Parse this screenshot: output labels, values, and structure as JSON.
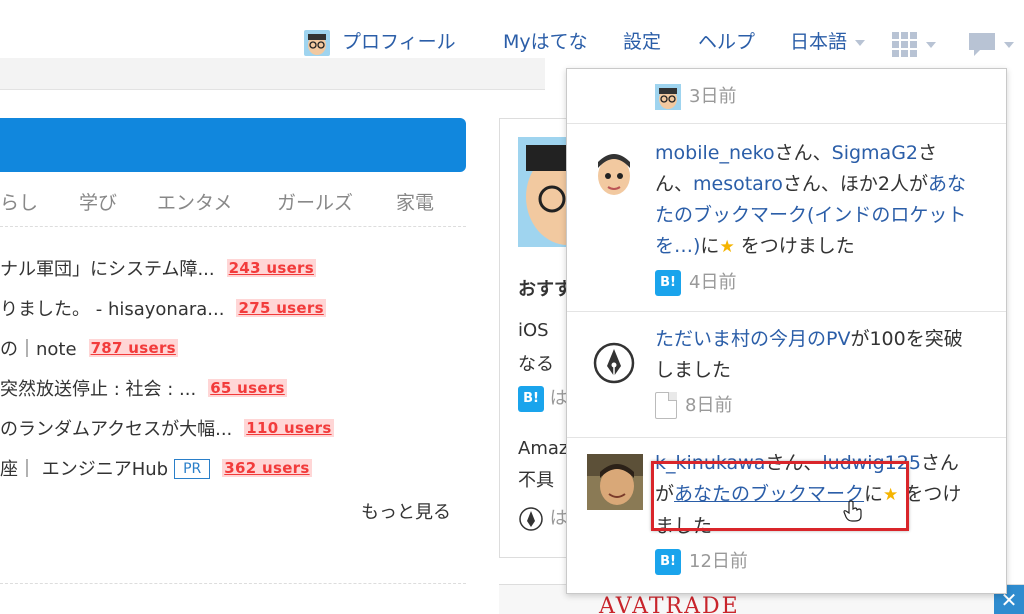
{
  "header": {
    "profile_label": "プロフィール",
    "myhatena_label": "Myはてな",
    "settings_label": "設定",
    "help_label": "ヘルプ",
    "language_label": "日本語"
  },
  "categories": [
    "らし",
    "学び",
    "エンタメ",
    "ガールズ",
    "家電"
  ],
  "entries": [
    {
      "title": "ナル軍団」にシステム障...",
      "users": "243 users"
    },
    {
      "title": "りました。 - hisayonara...",
      "users": "275 users"
    },
    {
      "title": "の｜note",
      "users": "787 users"
    },
    {
      "title": "突然放送停止 : 社会 : ...",
      "users": "65 users"
    },
    {
      "title": "のランダムアクセスが大幅...",
      "users": "110 users"
    },
    {
      "title": "座｜ エンジニアHub",
      "pr": "PR",
      "users": "362 users"
    }
  ],
  "more_label": "もっと見る",
  "middle": {
    "heading": "おすす",
    "line1": "iOS ",
    "line2": "なる",
    "line3": "Amaz",
    "line4": "不具",
    "b_letter": "B!",
    "partial1": "は",
    "partial2": "は"
  },
  "notifications": [
    {
      "time": "3日前"
    },
    {
      "user1": "mobile_neko",
      "mid1": "さん、",
      "user2": "SigmaG2",
      "mid2": "さん、",
      "user3": "mesotaro",
      "mid3": "さん、ほか2人が",
      "link": "あなたのブックマーク(インドのロケットを…)",
      "tail": "に",
      "tail2": " をつけました",
      "badge": "B!",
      "time": "4日前"
    },
    {
      "link": "ただいま村の今月のPV",
      "tail": "が100を突破しました",
      "time": "8日前"
    },
    {
      "user1": "k_kinukawa",
      "mid1": "さん、",
      "user2": "ludwig125",
      "mid2": "さん",
      "mid3": "が",
      "link": "あなたのブックマーク",
      "tail": "に",
      "tail2": " をつけました",
      "badge": "B!",
      "time": "12日前"
    }
  ],
  "ad": {
    "brand": "AVATRADE",
    "close": "✕"
  },
  "colors": {
    "accent": "#1187dd",
    "link": "#2b5ea8",
    "users_red": "#f23b3b",
    "highlight": "#d9252a"
  }
}
